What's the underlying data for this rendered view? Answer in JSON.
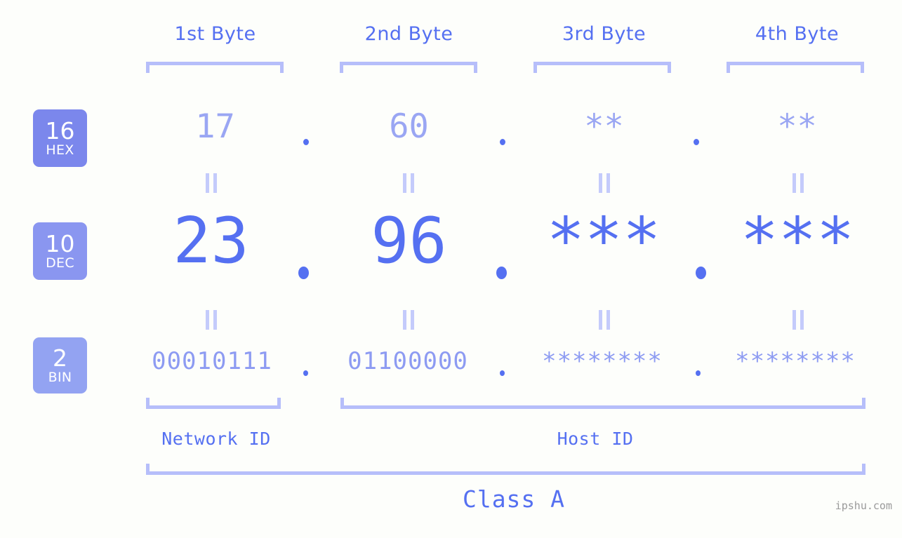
{
  "background_color": "#fdfefb",
  "accent_color": "#5570f1",
  "accent_light_color": "#9aa6f3",
  "bracket_color": "#b6befa",
  "byte_headers": [
    {
      "label": "1st Byte"
    },
    {
      "label": "2nd Byte"
    },
    {
      "label": "3rd Byte"
    },
    {
      "label": "4th Byte"
    }
  ],
  "rows": [
    {
      "base": "16",
      "unit": "HEX",
      "badge_color": "#7b87ec",
      "values": [
        "17",
        "60",
        "**",
        "**"
      ],
      "separator": "."
    },
    {
      "base": "10",
      "unit": "DEC",
      "badge_color": "#8a96f0",
      "values": [
        "23",
        "96",
        "***",
        "***"
      ],
      "separator": "."
    },
    {
      "base": "2",
      "unit": "BIN",
      "badge_color": "#93a3f2",
      "values": [
        "00010111",
        "01100000",
        "********",
        "********"
      ],
      "separator": "."
    }
  ],
  "equality_symbol": "=",
  "sections": [
    {
      "label": "Network ID"
    },
    {
      "label": "Host ID"
    }
  ],
  "class": {
    "label": "Class A"
  },
  "watermark": {
    "text": "ipshu.com"
  }
}
